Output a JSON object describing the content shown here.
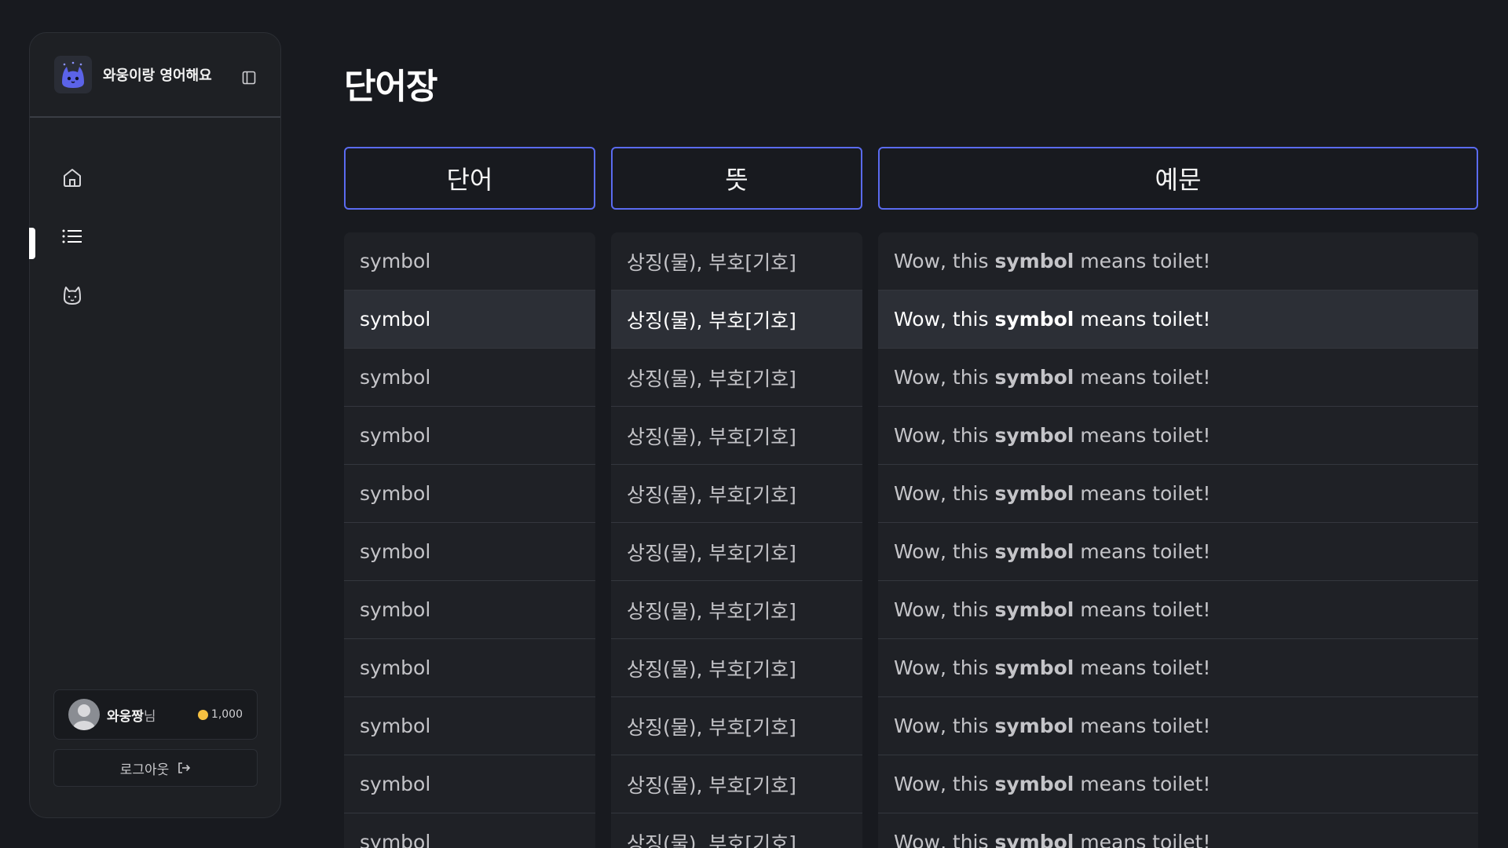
{
  "app": {
    "name": "와웅이랑 영어해요"
  },
  "sidebar": {
    "nav": [
      {
        "icon": "home-icon"
      },
      {
        "icon": "list-icon",
        "active": true
      },
      {
        "icon": "cat-icon"
      }
    ],
    "user": {
      "name": "와웅짱",
      "suffix": "님",
      "coins": "1,000"
    },
    "logout_label": "로그아웃"
  },
  "page": {
    "title": "단어장"
  },
  "table": {
    "headers": {
      "word": "단어",
      "meaning": "뜻",
      "example": "예문"
    },
    "highlighted_row": 1,
    "rows": [
      {
        "word": "symbol",
        "meaning": "상징(물), 부호[기호]",
        "ex_pre": "Wow, this ",
        "ex_word": "symbol",
        "ex_post": " means toilet!"
      },
      {
        "word": "symbol",
        "meaning": "상징(물), 부호[기호]",
        "ex_pre": "Wow, this ",
        "ex_word": "symbol",
        "ex_post": " means toilet!"
      },
      {
        "word": "symbol",
        "meaning": "상징(물), 부호[기호]",
        "ex_pre": "Wow, this ",
        "ex_word": "symbol",
        "ex_post": " means toilet!"
      },
      {
        "word": "symbol",
        "meaning": "상징(물), 부호[기호]",
        "ex_pre": "Wow, this ",
        "ex_word": "symbol",
        "ex_post": " means toilet!"
      },
      {
        "word": "symbol",
        "meaning": "상징(물), 부호[기호]",
        "ex_pre": "Wow, this ",
        "ex_word": "symbol",
        "ex_post": " means toilet!"
      },
      {
        "word": "symbol",
        "meaning": "상징(물), 부호[기호]",
        "ex_pre": "Wow, this ",
        "ex_word": "symbol",
        "ex_post": " means toilet!"
      },
      {
        "word": "symbol",
        "meaning": "상징(물), 부호[기호]",
        "ex_pre": "Wow, this ",
        "ex_word": "symbol",
        "ex_post": " means toilet!"
      },
      {
        "word": "symbol",
        "meaning": "상징(물), 부호[기호]",
        "ex_pre": "Wow, this ",
        "ex_word": "symbol",
        "ex_post": " means toilet!"
      },
      {
        "word": "symbol",
        "meaning": "상징(물), 부호[기호]",
        "ex_pre": "Wow, this ",
        "ex_word": "symbol",
        "ex_post": " means toilet!"
      },
      {
        "word": "symbol",
        "meaning": "상징(물), 부호[기호]",
        "ex_pre": "Wow, this ",
        "ex_word": "symbol",
        "ex_post": " means toilet!"
      },
      {
        "word": "symbol",
        "meaning": "상징(물), 부호[기호]",
        "ex_pre": "Wow, this ",
        "ex_word": "symbol",
        "ex_post": " means toilet!"
      }
    ]
  },
  "colors": {
    "accent": "#5a6bf0",
    "coin": "#f5c041",
    "background": "#181a1f"
  }
}
